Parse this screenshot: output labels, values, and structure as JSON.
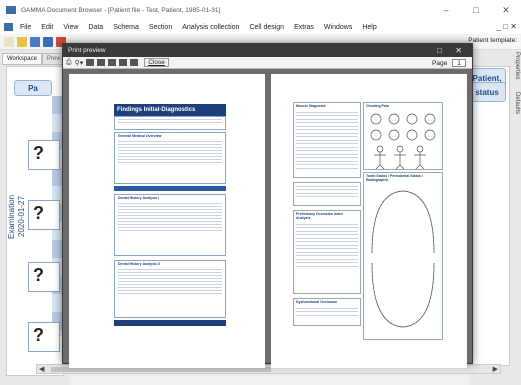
{
  "window": {
    "title": "GAMMA Document Browser - [Patient file - Test, Patient, 1985-01-31]"
  },
  "menu": {
    "items": [
      "File",
      "Edit",
      "View",
      "Data",
      "Schema",
      "Section",
      "Analysis collection",
      "Cell design",
      "Extras",
      "Windows",
      "Help"
    ]
  },
  "toolbar": {
    "template_label": "Patient template:"
  },
  "tabs": {
    "workspace": "Workspace",
    "preview": "Previ"
  },
  "main": {
    "patient_header_left": "Pa",
    "exam_label": "Examination",
    "exam_date": "2020-01-27",
    "cells": [
      "?",
      "?",
      "?",
      "?"
    ]
  },
  "right_panel": {
    "badge1": "Patient,",
    "badge2": "status",
    "side_tabs": [
      "Properties",
      "Defaults"
    ]
  },
  "preview_dialog": {
    "title": "Print preview",
    "close_label": "Close",
    "page_label": "Page",
    "page_value": "1"
  },
  "page1": {
    "heading": "Findings Initial-Diagnostics",
    "sections": [
      "General Medical Overview",
      "Dental History Analysis I",
      "Dental History Analysis II"
    ]
  },
  "page2": {
    "sections": [
      "Muscle Diagnosis",
      "Chewing Pain",
      "Tooth Status / Periodontal Status / Radiographic",
      "Preliminary Occlusion Index Analysis",
      "Dysfunctional Occlusion"
    ]
  }
}
